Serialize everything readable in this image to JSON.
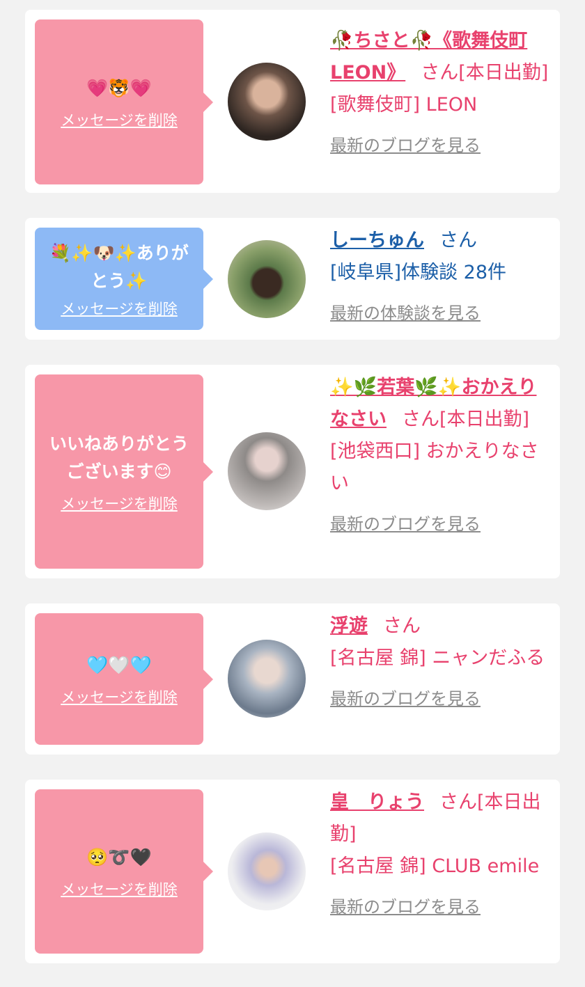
{
  "cards": [
    {
      "message": "💗🐯💗",
      "delete_label": "メッセージを削除",
      "name": "🥀ちさと🥀《歌舞伎町LEON》",
      "san_text": "さん[本日出勤]",
      "shop": "[歌舞伎町] LEON",
      "link": "最新のブログを見る"
    },
    {
      "message": "💐✨🐶✨ありがとう✨",
      "delete_label": "メッセージを削除",
      "name": "しーちゅん",
      "san_text": "さん",
      "shop": "[岐阜県]体験談 28件",
      "link": "最新の体験談を見る"
    },
    {
      "message": "いいねありがとうございます😊",
      "delete_label": "メッセージを削除",
      "name": "✨🌿若葉🌿✨おかえりなさい",
      "san_text": "さん[本日出勤]",
      "shop": "[池袋西口] おかえりなさい",
      "link": "最新のブログを見る"
    },
    {
      "message": "🩵🤍🩵",
      "delete_label": "メッセージを削除",
      "name": "浮遊",
      "san_text": "さん",
      "shop": "[名古屋 錦] ニャンだふる",
      "link": "最新のブログを見る"
    },
    {
      "message": "🥺➰🖤",
      "delete_label": "メッセージを削除",
      "name": "皇　りょう",
      "san_text": "さん[本日出勤]",
      "shop": "[名古屋 錦] CLUB emile",
      "link": "最新のブログを見る"
    }
  ],
  "colors": {
    "pink_bubble": "#f797a8",
    "blue_bubble": "#8db9f5",
    "pink_text": "#e8416d",
    "blue_text": "#1c5fa8"
  }
}
